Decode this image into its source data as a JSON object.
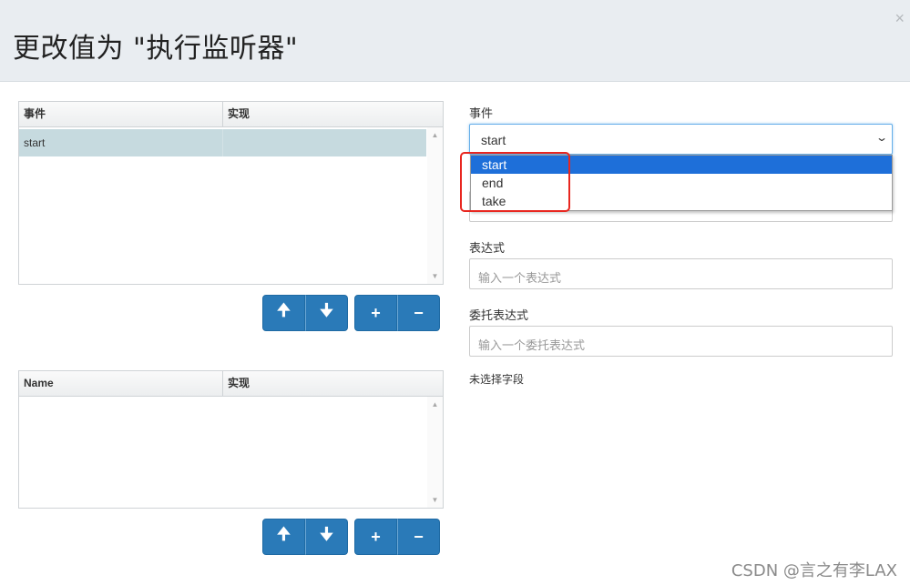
{
  "dialog": {
    "title": "更改值为 \"执行监听器\"",
    "close_glyph": "×"
  },
  "listeners_grid": {
    "columns": [
      "事件",
      "实现"
    ],
    "rows": [
      {
        "event": "start",
        "implementation": ""
      }
    ]
  },
  "fields_grid": {
    "columns": [
      "Name",
      "实现"
    ],
    "rows": []
  },
  "buttons": {
    "move_up": "🠉",
    "move_down": "🠋",
    "add": "+",
    "remove": "−"
  },
  "form": {
    "event_label": "事件",
    "event_value": "start",
    "event_options": [
      "start",
      "end",
      "take"
    ],
    "event_selected_option": "start",
    "expression_label": "表达式",
    "expression_placeholder": "输入一个表达式",
    "delegate_label": "委托表达式",
    "delegate_placeholder": "输入一个委托表达式",
    "no_field_selected": "未选择字段"
  },
  "watermark": "CSDN @言之有李LAX",
  "icons": {
    "close": "close-icon",
    "up": "arrow-up-icon",
    "down": "arrow-down-icon",
    "add": "plus-icon",
    "remove": "minus-icon",
    "dropdown": "chevron-down-icon"
  },
  "colors": {
    "header_bg": "#e9edf1",
    "button_blue": "#2a7ab8",
    "selected_row": "#c6dadf",
    "selected_option": "#1e6fd9",
    "highlight_box": "#e8261f"
  }
}
